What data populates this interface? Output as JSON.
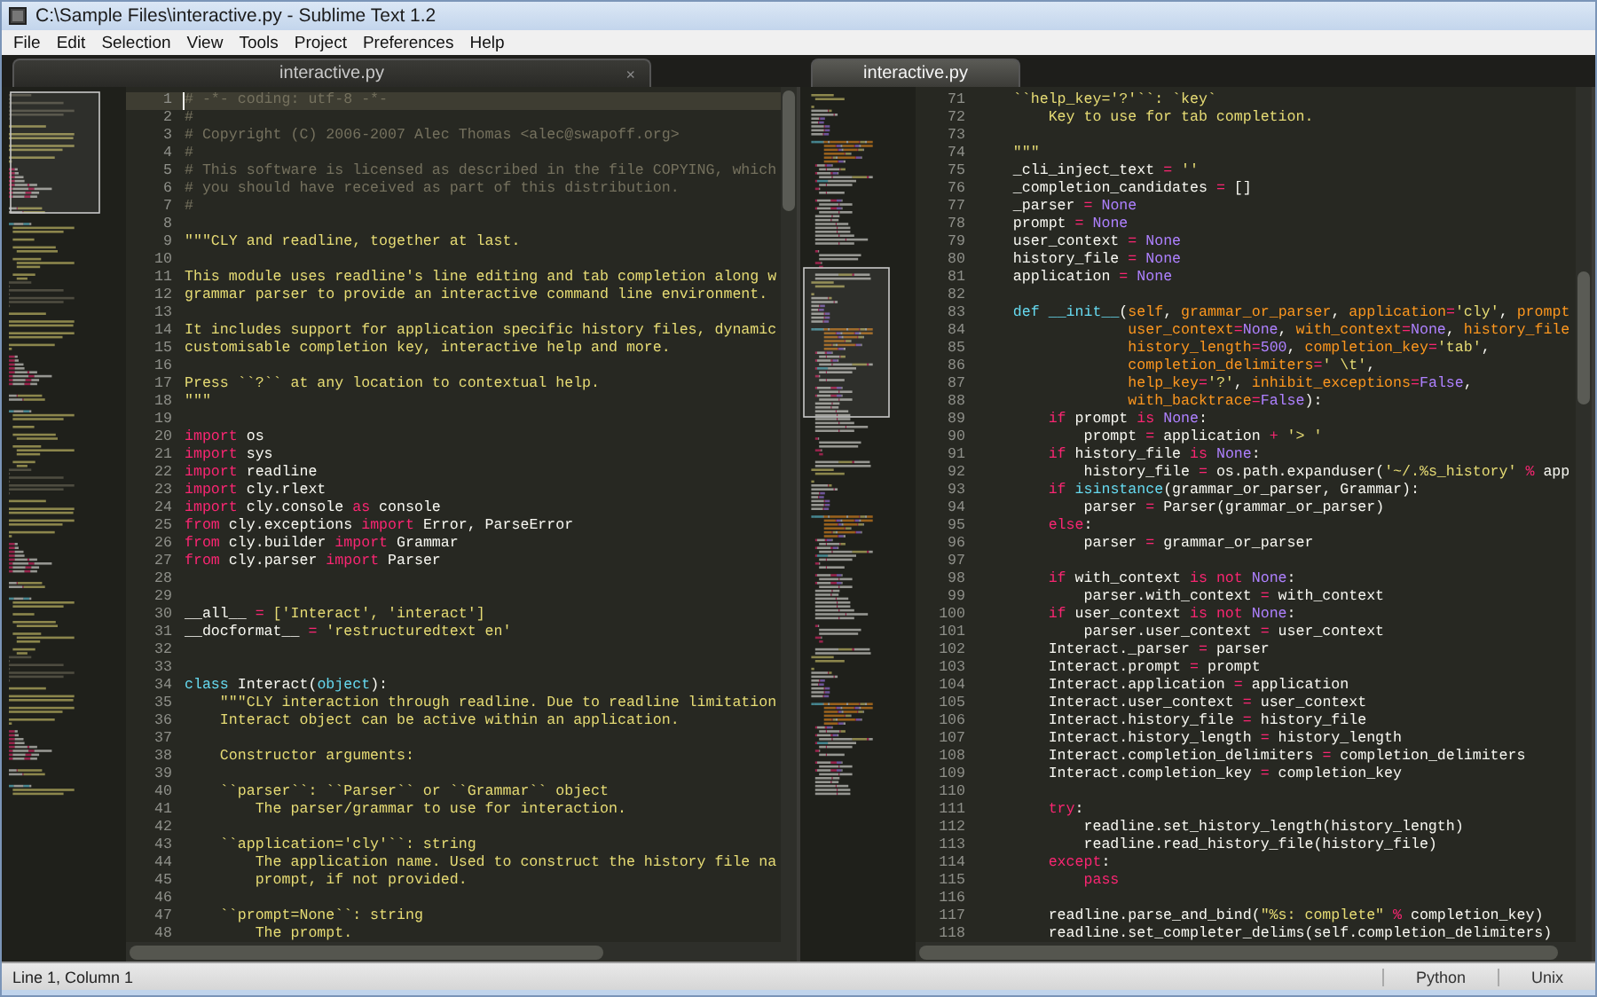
{
  "window": {
    "title": "C:\\Sample Files\\interactive.py - Sublime Text 1.2"
  },
  "menu": [
    "File",
    "Edit",
    "Selection",
    "View",
    "Tools",
    "Project",
    "Preferences",
    "Help"
  ],
  "panes": [
    {
      "tab": {
        "label": "interactive.py",
        "selected": false,
        "close": "×"
      },
      "lines": [
        {
          "number": "1",
          "current": true,
          "tokens": [
            {
              "kind": "comment",
              "text": "# -*- coding: utf-8 -*-"
            }
          ]
        },
        {
          "number": "2",
          "tokens": [
            {
              "kind": "comment",
              "text": "#"
            }
          ]
        },
        {
          "number": "3",
          "tokens": [
            {
              "kind": "comment",
              "text": "# Copyright (C) 2006-2007 Alec Thomas <alec@swapoff.org>"
            }
          ]
        },
        {
          "number": "4",
          "tokens": [
            {
              "kind": "comment",
              "text": "#"
            }
          ]
        },
        {
          "number": "5",
          "tokens": [
            {
              "kind": "comment",
              "text": "# This software is licensed as described in the file COPYING, which"
            }
          ]
        },
        {
          "number": "6",
          "tokens": [
            {
              "kind": "comment",
              "text": "# you should have received as part of this distribution."
            }
          ]
        },
        {
          "number": "7",
          "tokens": [
            {
              "kind": "comment",
              "text": "#"
            }
          ]
        },
        {
          "number": "8"
        },
        {
          "number": "9",
          "tokens": [
            {
              "kind": "string",
              "text": "\"\"\"CLY and readline, together at last."
            }
          ]
        },
        {
          "number": "10"
        },
        {
          "number": "11",
          "tokens": [
            {
              "kind": "string",
              "text": "This module uses readline's line editing and tab completion along w"
            }
          ]
        },
        {
          "number": "12",
          "tokens": [
            {
              "kind": "string",
              "text": "grammar parser to provide an interactive command line environment."
            }
          ]
        },
        {
          "number": "13"
        },
        {
          "number": "14",
          "tokens": [
            {
              "kind": "string",
              "text": "It includes support for application specific history files, dynamic"
            }
          ]
        },
        {
          "number": "15",
          "tokens": [
            {
              "kind": "string",
              "text": "customisable completion key, interactive help and more."
            }
          ]
        },
        {
          "number": "16"
        },
        {
          "number": "17",
          "tokens": [
            {
              "kind": "string",
              "text": "Press ``?`` at any location to contextual help."
            }
          ]
        },
        {
          "number": "18",
          "tokens": [
            {
              "kind": "string",
              "text": "\"\"\""
            }
          ]
        },
        {
          "number": "19"
        },
        {
          "number": "20",
          "tokens": [
            {
              "kind": "keyword",
              "text": "import"
            },
            {
              "kind": "plain",
              "text": " os"
            }
          ]
        },
        {
          "number": "21",
          "tokens": [
            {
              "kind": "keyword",
              "text": "import"
            },
            {
              "kind": "plain",
              "text": " sys"
            }
          ]
        },
        {
          "number": "22",
          "tokens": [
            {
              "kind": "keyword",
              "text": "import"
            },
            {
              "kind": "plain",
              "text": " readline"
            }
          ]
        },
        {
          "number": "23",
          "tokens": [
            {
              "kind": "keyword",
              "text": "import"
            },
            {
              "kind": "plain",
              "text": " cly.rlext"
            }
          ]
        },
        {
          "number": "24",
          "tokens": [
            {
              "kind": "keyword",
              "text": "import"
            },
            {
              "kind": "plain",
              "text": " cly.console "
            },
            {
              "kind": "keyword",
              "text": "as"
            },
            {
              "kind": "plain",
              "text": " console"
            }
          ]
        },
        {
          "number": "25",
          "tokens": [
            {
              "kind": "keyword",
              "text": "from"
            },
            {
              "kind": "plain",
              "text": " cly.exceptions "
            },
            {
              "kind": "keyword",
              "text": "import"
            },
            {
              "kind": "plain",
              "text": " Error, ParseError"
            }
          ]
        },
        {
          "number": "26",
          "tokens": [
            {
              "kind": "keyword",
              "text": "from"
            },
            {
              "kind": "plain",
              "text": " cly.builder "
            },
            {
              "kind": "keyword",
              "text": "import"
            },
            {
              "kind": "plain",
              "text": " Grammar"
            }
          ]
        },
        {
          "number": "27",
          "tokens": [
            {
              "kind": "keyword",
              "text": "from"
            },
            {
              "kind": "plain",
              "text": " cly.parser "
            },
            {
              "kind": "keyword",
              "text": "import"
            },
            {
              "kind": "plain",
              "text": " Parser"
            }
          ]
        },
        {
          "number": "28"
        },
        {
          "number": "29"
        },
        {
          "number": "30",
          "tokens": [
            {
              "kind": "plain",
              "text": "__all__ "
            },
            {
              "kind": "operator",
              "text": "="
            },
            {
              "kind": "string",
              "text": " ['Interact', 'interact']"
            }
          ]
        },
        {
          "number": "31",
          "tokens": [
            {
              "kind": "plain",
              "text": "__docformat__ "
            },
            {
              "kind": "operator",
              "text": "="
            },
            {
              "kind": "string",
              "text": " 'restructuredtext en'"
            }
          ]
        },
        {
          "number": "32"
        },
        {
          "number": "33"
        },
        {
          "number": "34",
          "tokens": [
            {
              "kind": "builtin",
              "text": "class"
            },
            {
              "kind": "plain",
              "text": " Interact("
            },
            {
              "kind": "builtin",
              "text": "object"
            },
            {
              "kind": "plain",
              "text": "):"
            }
          ]
        },
        {
          "number": "35",
          "tokens": [
            {
              "kind": "string",
              "text": "    \"\"\"CLY interaction through readline. Due to readline limitation"
            }
          ]
        },
        {
          "number": "36",
          "tokens": [
            {
              "kind": "string",
              "text": "    Interact object can be active within an application."
            }
          ]
        },
        {
          "number": "37"
        },
        {
          "number": "38",
          "tokens": [
            {
              "kind": "string",
              "text": "    Constructor arguments:"
            }
          ]
        },
        {
          "number": "39"
        },
        {
          "number": "40",
          "tokens": [
            {
              "kind": "string",
              "text": "    ``parser``: ``Parser`` or ``Grammar`` object"
            }
          ]
        },
        {
          "number": "41",
          "tokens": [
            {
              "kind": "string",
              "text": "        The parser/grammar to use for interaction."
            }
          ]
        },
        {
          "number": "42"
        },
        {
          "number": "43",
          "tokens": [
            {
              "kind": "string",
              "text": "    ``application='cly'``: string"
            }
          ]
        },
        {
          "number": "44",
          "tokens": [
            {
              "kind": "string",
              "text": "        The application name. Used to construct the history file na"
            }
          ]
        },
        {
          "number": "45",
          "tokens": [
            {
              "kind": "string",
              "text": "        prompt, if not provided."
            }
          ]
        },
        {
          "number": "46"
        },
        {
          "number": "47",
          "tokens": [
            {
              "kind": "string",
              "text": "    ``prompt=None``: string"
            }
          ]
        },
        {
          "number": "48",
          "tokens": [
            {
              "kind": "string",
              "text": "        The prompt."
            }
          ]
        }
      ]
    },
    {
      "tab": {
        "label": "interactive.py",
        "selected": true
      },
      "lines": [
        {
          "number": "71",
          "tokens": [
            {
              "kind": "string",
              "text": "    ``help_key='?'``: `key`"
            }
          ]
        },
        {
          "number": "72",
          "tokens": [
            {
              "kind": "string",
              "text": "        Key to use for tab completion."
            }
          ]
        },
        {
          "number": "73"
        },
        {
          "number": "74",
          "tokens": [
            {
              "kind": "string",
              "text": "    \"\"\""
            }
          ]
        },
        {
          "number": "75",
          "tokens": [
            {
              "kind": "plain",
              "text": "    _cli_inject_text "
            },
            {
              "kind": "operator",
              "text": "="
            },
            {
              "kind": "string",
              "text": " ''"
            }
          ]
        },
        {
          "number": "76",
          "tokens": [
            {
              "kind": "plain",
              "text": "    _completion_candidates "
            },
            {
              "kind": "operator",
              "text": "="
            },
            {
              "kind": "plain",
              "text": " []"
            }
          ]
        },
        {
          "number": "77",
          "tokens": [
            {
              "kind": "plain",
              "text": "    _parser "
            },
            {
              "kind": "operator",
              "text": "="
            },
            {
              "kind": "constant",
              "text": " None"
            }
          ]
        },
        {
          "number": "78",
          "tokens": [
            {
              "kind": "plain",
              "text": "    prompt "
            },
            {
              "kind": "operator",
              "text": "="
            },
            {
              "kind": "constant",
              "text": " None"
            }
          ]
        },
        {
          "number": "79",
          "tokens": [
            {
              "kind": "plain",
              "text": "    user_context "
            },
            {
              "kind": "operator",
              "text": "="
            },
            {
              "kind": "constant",
              "text": " None"
            }
          ]
        },
        {
          "number": "80",
          "tokens": [
            {
              "kind": "plain",
              "text": "    history_file "
            },
            {
              "kind": "operator",
              "text": "="
            },
            {
              "kind": "constant",
              "text": " None"
            }
          ]
        },
        {
          "number": "81",
          "tokens": [
            {
              "kind": "plain",
              "text": "    application "
            },
            {
              "kind": "operator",
              "text": "="
            },
            {
              "kind": "constant",
              "text": " None"
            }
          ]
        },
        {
          "number": "82"
        },
        {
          "number": "83",
          "tokens": [
            {
              "kind": "builtin",
              "text": "    def"
            },
            {
              "kind": "builtin",
              "text": " __init__"
            },
            {
              "kind": "plain",
              "text": "("
            },
            {
              "kind": "param",
              "text": "self"
            },
            {
              "kind": "plain",
              "text": ", "
            },
            {
              "kind": "param",
              "text": "grammar_or_parser"
            },
            {
              "kind": "plain",
              "text": ", "
            },
            {
              "kind": "param",
              "text": "application"
            },
            {
              "kind": "operator",
              "text": "="
            },
            {
              "kind": "string",
              "text": "'cly'"
            },
            {
              "kind": "plain",
              "text": ", "
            },
            {
              "kind": "param",
              "text": "prompt"
            }
          ]
        },
        {
          "number": "84",
          "tokens": [
            {
              "kind": "param",
              "text": "                 user_context"
            },
            {
              "kind": "operator",
              "text": "="
            },
            {
              "kind": "constant",
              "text": "None"
            },
            {
              "kind": "plain",
              "text": ", "
            },
            {
              "kind": "param",
              "text": "with_context"
            },
            {
              "kind": "operator",
              "text": "="
            },
            {
              "kind": "constant",
              "text": "None"
            },
            {
              "kind": "plain",
              "text": ", "
            },
            {
              "kind": "param",
              "text": "history_file"
            }
          ]
        },
        {
          "number": "85",
          "tokens": [
            {
              "kind": "param",
              "text": "                 history_length"
            },
            {
              "kind": "operator",
              "text": "="
            },
            {
              "kind": "constant",
              "text": "500"
            },
            {
              "kind": "plain",
              "text": ", "
            },
            {
              "kind": "param",
              "text": "completion_key"
            },
            {
              "kind": "operator",
              "text": "="
            },
            {
              "kind": "string",
              "text": "'tab'"
            },
            {
              "kind": "plain",
              "text": ","
            }
          ]
        },
        {
          "number": "86",
          "tokens": [
            {
              "kind": "param",
              "text": "                 completion_delimiters"
            },
            {
              "kind": "operator",
              "text": "="
            },
            {
              "kind": "string",
              "text": "' \\t'"
            },
            {
              "kind": "plain",
              "text": ","
            }
          ]
        },
        {
          "number": "87",
          "tokens": [
            {
              "kind": "param",
              "text": "                 help_key"
            },
            {
              "kind": "operator",
              "text": "="
            },
            {
              "kind": "string",
              "text": "'?'"
            },
            {
              "kind": "plain",
              "text": ", "
            },
            {
              "kind": "param",
              "text": "inhibit_exceptions"
            },
            {
              "kind": "operator",
              "text": "="
            },
            {
              "kind": "constant",
              "text": "False"
            },
            {
              "kind": "plain",
              "text": ","
            }
          ]
        },
        {
          "number": "88",
          "tokens": [
            {
              "kind": "param",
              "text": "                 with_backtrace"
            },
            {
              "kind": "operator",
              "text": "="
            },
            {
              "kind": "constant",
              "text": "False"
            },
            {
              "kind": "plain",
              "text": "):"
            }
          ]
        },
        {
          "number": "89",
          "tokens": [
            {
              "kind": "keyword",
              "text": "        if"
            },
            {
              "kind": "plain",
              "text": " prompt "
            },
            {
              "kind": "keyword",
              "text": "is"
            },
            {
              "kind": "constant",
              "text": " None"
            },
            {
              "kind": "plain",
              "text": ":"
            }
          ]
        },
        {
          "number": "90",
          "tokens": [
            {
              "kind": "plain",
              "text": "            prompt "
            },
            {
              "kind": "operator",
              "text": "="
            },
            {
              "kind": "plain",
              "text": " application "
            },
            {
              "kind": "operator",
              "text": "+"
            },
            {
              "kind": "string",
              "text": " '> '"
            }
          ]
        },
        {
          "number": "91",
          "tokens": [
            {
              "kind": "keyword",
              "text": "        if"
            },
            {
              "kind": "plain",
              "text": " history_file "
            },
            {
              "kind": "keyword",
              "text": "is"
            },
            {
              "kind": "constant",
              "text": " None"
            },
            {
              "kind": "plain",
              "text": ":"
            }
          ]
        },
        {
          "number": "92",
          "tokens": [
            {
              "kind": "plain",
              "text": "            history_file "
            },
            {
              "kind": "operator",
              "text": "="
            },
            {
              "kind": "plain",
              "text": " os.path.expanduser("
            },
            {
              "kind": "string",
              "text": "'~/.%s_history'"
            },
            {
              "kind": "operator",
              "text": " %"
            },
            {
              "kind": "plain",
              "text": " app"
            }
          ]
        },
        {
          "number": "93",
          "tokens": [
            {
              "kind": "keyword",
              "text": "        if"
            },
            {
              "kind": "builtin",
              "text": " isinstance"
            },
            {
              "kind": "plain",
              "text": "(grammar_or_parser, Grammar):"
            }
          ]
        },
        {
          "number": "94",
          "tokens": [
            {
              "kind": "plain",
              "text": "            parser "
            },
            {
              "kind": "operator",
              "text": "="
            },
            {
              "kind": "plain",
              "text": " Parser(grammar_or_parser)"
            }
          ]
        },
        {
          "number": "95",
          "tokens": [
            {
              "kind": "keyword",
              "text": "        else"
            },
            {
              "kind": "plain",
              "text": ":"
            }
          ]
        },
        {
          "number": "96",
          "tokens": [
            {
              "kind": "plain",
              "text": "            parser "
            },
            {
              "kind": "operator",
              "text": "="
            },
            {
              "kind": "plain",
              "text": " grammar_or_parser"
            }
          ]
        },
        {
          "number": "97"
        },
        {
          "number": "98",
          "tokens": [
            {
              "kind": "keyword",
              "text": "        if"
            },
            {
              "kind": "plain",
              "text": " with_context "
            },
            {
              "kind": "keyword",
              "text": "is not"
            },
            {
              "kind": "constant",
              "text": " None"
            },
            {
              "kind": "plain",
              "text": ":"
            }
          ]
        },
        {
          "number": "99",
          "tokens": [
            {
              "kind": "plain",
              "text": "            parser.with_context "
            },
            {
              "kind": "operator",
              "text": "="
            },
            {
              "kind": "plain",
              "text": " with_context"
            }
          ]
        },
        {
          "number": "100",
          "tokens": [
            {
              "kind": "keyword",
              "text": "        if"
            },
            {
              "kind": "plain",
              "text": " user_context "
            },
            {
              "kind": "keyword",
              "text": "is not"
            },
            {
              "kind": "constant",
              "text": " None"
            },
            {
              "kind": "plain",
              "text": ":"
            }
          ]
        },
        {
          "number": "101",
          "tokens": [
            {
              "kind": "plain",
              "text": "            parser.user_context "
            },
            {
              "kind": "operator",
              "text": "="
            },
            {
              "kind": "plain",
              "text": " user_context"
            }
          ]
        },
        {
          "number": "102",
          "tokens": [
            {
              "kind": "plain",
              "text": "        Interact._parser "
            },
            {
              "kind": "operator",
              "text": "="
            },
            {
              "kind": "plain",
              "text": " parser"
            }
          ]
        },
        {
          "number": "103",
          "tokens": [
            {
              "kind": "plain",
              "text": "        Interact.prompt "
            },
            {
              "kind": "operator",
              "text": "="
            },
            {
              "kind": "plain",
              "text": " prompt"
            }
          ]
        },
        {
          "number": "104",
          "tokens": [
            {
              "kind": "plain",
              "text": "        Interact.application "
            },
            {
              "kind": "operator",
              "text": "="
            },
            {
              "kind": "plain",
              "text": " application"
            }
          ]
        },
        {
          "number": "105",
          "tokens": [
            {
              "kind": "plain",
              "text": "        Interact.user_context "
            },
            {
              "kind": "operator",
              "text": "="
            },
            {
              "kind": "plain",
              "text": " user_context"
            }
          ]
        },
        {
          "number": "106",
          "tokens": [
            {
              "kind": "plain",
              "text": "        Interact.history_file "
            },
            {
              "kind": "operator",
              "text": "="
            },
            {
              "kind": "plain",
              "text": " history_file"
            }
          ]
        },
        {
          "number": "107",
          "tokens": [
            {
              "kind": "plain",
              "text": "        Interact.history_length "
            },
            {
              "kind": "operator",
              "text": "="
            },
            {
              "kind": "plain",
              "text": " history_length"
            }
          ]
        },
        {
          "number": "108",
          "tokens": [
            {
              "kind": "plain",
              "text": "        Interact.completion_delimiters "
            },
            {
              "kind": "operator",
              "text": "="
            },
            {
              "kind": "plain",
              "text": " completion_delimiters"
            }
          ]
        },
        {
          "number": "109",
          "tokens": [
            {
              "kind": "plain",
              "text": "        Interact.completion_key "
            },
            {
              "kind": "operator",
              "text": "="
            },
            {
              "kind": "plain",
              "text": " completion_key"
            }
          ]
        },
        {
          "number": "110"
        },
        {
          "number": "111",
          "tokens": [
            {
              "kind": "keyword",
              "text": "        try"
            },
            {
              "kind": "plain",
              "text": ":"
            }
          ]
        },
        {
          "number": "112",
          "tokens": [
            {
              "kind": "plain",
              "text": "            readline.set_history_length(history_length)"
            }
          ]
        },
        {
          "number": "113",
          "tokens": [
            {
              "kind": "plain",
              "text": "            readline.read_history_file(history_file)"
            }
          ]
        },
        {
          "number": "114",
          "tokens": [
            {
              "kind": "keyword",
              "text": "        except"
            },
            {
              "kind": "plain",
              "text": ":"
            }
          ]
        },
        {
          "number": "115",
          "tokens": [
            {
              "kind": "keyword",
              "text": "            pass"
            }
          ]
        },
        {
          "number": "116"
        },
        {
          "number": "117",
          "tokens": [
            {
              "kind": "plain",
              "text": "        readline.parse_and_bind("
            },
            {
              "kind": "string",
              "text": "\"%s: complete\""
            },
            {
              "kind": "operator",
              "text": " %"
            },
            {
              "kind": "plain",
              "text": " completion_key)"
            }
          ]
        },
        {
          "number": "118",
          "tokens": [
            {
              "kind": "plain",
              "text": "        readline.set_completer_delims(self.completion_delimiters)"
            }
          ]
        }
      ]
    }
  ],
  "status_bar": {
    "position": "Line 1, Column 1",
    "syntax": "Python",
    "line_endings": "Unix"
  }
}
